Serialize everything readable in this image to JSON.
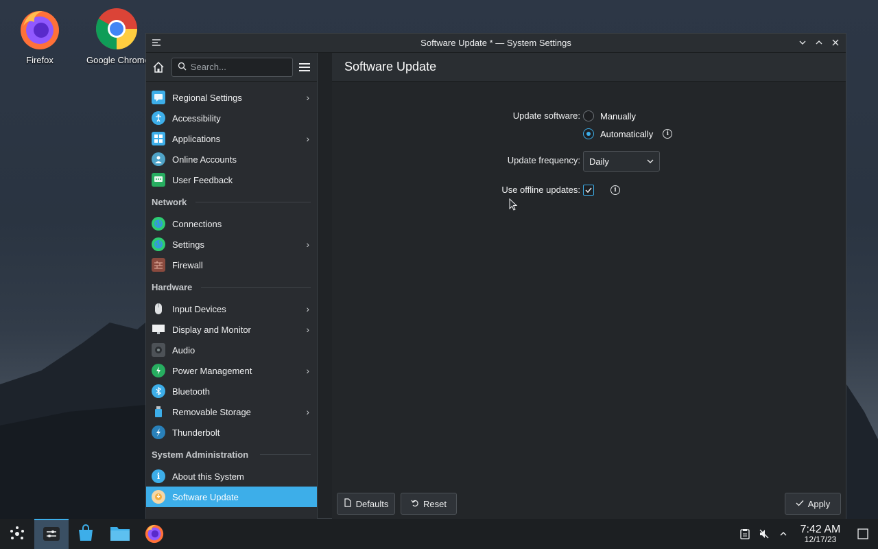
{
  "desktop": {
    "icons": [
      {
        "label": "Firefox",
        "icon": "firefox-icon"
      },
      {
        "label": "Google Chrome",
        "icon": "chrome-icon"
      }
    ]
  },
  "window": {
    "title": "Software Update * — System Settings"
  },
  "sidebar": {
    "search_placeholder": "Search...",
    "items_top": [
      {
        "label": "Regional Settings",
        "icon": "regional-settings-icon",
        "has_children": true,
        "color": "#3daee9"
      },
      {
        "label": "Accessibility",
        "icon": "accessibility-icon",
        "has_children": false,
        "color": "#3daee9"
      },
      {
        "label": "Applications",
        "icon": "applications-icon",
        "has_children": true,
        "color": "#3daee9"
      },
      {
        "label": "Online Accounts",
        "icon": "online-accounts-icon",
        "has_children": false,
        "color": "#4fa3c7"
      },
      {
        "label": "User Feedback",
        "icon": "user-feedback-icon",
        "has_children": false,
        "color": "#27ae60"
      }
    ],
    "network_header": "Network",
    "network_items": [
      {
        "label": "Connections",
        "icon": "globe-icon",
        "has_children": false
      },
      {
        "label": "Settings",
        "icon": "globe-icon",
        "has_children": true
      },
      {
        "label": "Firewall",
        "icon": "firewall-icon",
        "has_children": false
      }
    ],
    "hardware_header": "Hardware",
    "hardware_items": [
      {
        "label": "Input Devices",
        "icon": "mouse-icon",
        "has_children": true
      },
      {
        "label": "Display and Monitor",
        "icon": "monitor-icon",
        "has_children": true
      },
      {
        "label": "Audio",
        "icon": "speaker-icon",
        "has_children": false
      },
      {
        "label": "Power Management",
        "icon": "power-icon",
        "has_children": true
      },
      {
        "label": "Bluetooth",
        "icon": "bluetooth-icon",
        "has_children": false
      },
      {
        "label": "Removable Storage",
        "icon": "usb-icon",
        "has_children": true
      },
      {
        "label": "Thunderbolt",
        "icon": "thunderbolt-icon",
        "has_children": false
      }
    ],
    "sysadmin_header": "System Administration",
    "sysadmin_items": [
      {
        "label": "About this System",
        "icon": "info-icon",
        "has_children": false
      },
      {
        "label": "Software Update",
        "icon": "software-update-icon",
        "has_children": false,
        "active": true
      }
    ]
  },
  "main": {
    "title": "Software Update",
    "update_software_label": "Update software:",
    "option_manually": "Manually",
    "option_automatically": "Automatically",
    "selected_option": "Automatically",
    "update_frequency_label": "Update frequency:",
    "update_frequency_value": "Daily",
    "offline_updates_label": "Use offline updates:",
    "offline_updates_checked": true,
    "defaults_button": "Defaults",
    "reset_button": "Reset",
    "apply_button": "Apply"
  },
  "taskbar": {
    "time": "7:42 AM",
    "date": "12/17/23"
  },
  "colors": {
    "accent": "#3daee9",
    "window_bg": "#232629",
    "sidebar_bg": "#292c30"
  }
}
